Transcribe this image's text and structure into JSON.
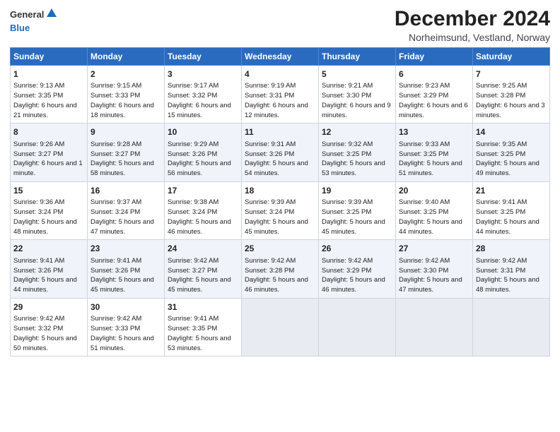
{
  "header": {
    "logo_general": "General",
    "logo_blue": "Blue",
    "title": "December 2024",
    "subtitle": "Norheimsund, Vestland, Norway"
  },
  "columns": [
    "Sunday",
    "Monday",
    "Tuesday",
    "Wednesday",
    "Thursday",
    "Friday",
    "Saturday"
  ],
  "weeks": [
    [
      {
        "day": "1",
        "sunrise": "9:13 AM",
        "sunset": "3:35 PM",
        "daylight": "6 hours and 21 minutes."
      },
      {
        "day": "2",
        "sunrise": "9:15 AM",
        "sunset": "3:33 PM",
        "daylight": "6 hours and 18 minutes."
      },
      {
        "day": "3",
        "sunrise": "9:17 AM",
        "sunset": "3:32 PM",
        "daylight": "6 hours and 15 minutes."
      },
      {
        "day": "4",
        "sunrise": "9:19 AM",
        "sunset": "3:31 PM",
        "daylight": "6 hours and 12 minutes."
      },
      {
        "day": "5",
        "sunrise": "9:21 AM",
        "sunset": "3:30 PM",
        "daylight": "6 hours and 9 minutes."
      },
      {
        "day": "6",
        "sunrise": "9:23 AM",
        "sunset": "3:29 PM",
        "daylight": "6 hours and 6 minutes."
      },
      {
        "day": "7",
        "sunrise": "9:25 AM",
        "sunset": "3:28 PM",
        "daylight": "6 hours and 3 minutes."
      }
    ],
    [
      {
        "day": "8",
        "sunrise": "9:26 AM",
        "sunset": "3:27 PM",
        "daylight": "6 hours and 1 minute."
      },
      {
        "day": "9",
        "sunrise": "9:28 AM",
        "sunset": "3:27 PM",
        "daylight": "5 hours and 58 minutes."
      },
      {
        "day": "10",
        "sunrise": "9:29 AM",
        "sunset": "3:26 PM",
        "daylight": "5 hours and 56 minutes."
      },
      {
        "day": "11",
        "sunrise": "9:31 AM",
        "sunset": "3:26 PM",
        "daylight": "5 hours and 54 minutes."
      },
      {
        "day": "12",
        "sunrise": "9:32 AM",
        "sunset": "3:25 PM",
        "daylight": "5 hours and 53 minutes."
      },
      {
        "day": "13",
        "sunrise": "9:33 AM",
        "sunset": "3:25 PM",
        "daylight": "5 hours and 51 minutes."
      },
      {
        "day": "14",
        "sunrise": "9:35 AM",
        "sunset": "3:25 PM",
        "daylight": "5 hours and 49 minutes."
      }
    ],
    [
      {
        "day": "15",
        "sunrise": "9:36 AM",
        "sunset": "3:24 PM",
        "daylight": "5 hours and 48 minutes."
      },
      {
        "day": "16",
        "sunrise": "9:37 AM",
        "sunset": "3:24 PM",
        "daylight": "5 hours and 47 minutes."
      },
      {
        "day": "17",
        "sunrise": "9:38 AM",
        "sunset": "3:24 PM",
        "daylight": "5 hours and 46 minutes."
      },
      {
        "day": "18",
        "sunrise": "9:39 AM",
        "sunset": "3:24 PM",
        "daylight": "5 hours and 45 minutes."
      },
      {
        "day": "19",
        "sunrise": "9:39 AM",
        "sunset": "3:25 PM",
        "daylight": "5 hours and 45 minutes."
      },
      {
        "day": "20",
        "sunrise": "9:40 AM",
        "sunset": "3:25 PM",
        "daylight": "5 hours and 44 minutes."
      },
      {
        "day": "21",
        "sunrise": "9:41 AM",
        "sunset": "3:25 PM",
        "daylight": "5 hours and 44 minutes."
      }
    ],
    [
      {
        "day": "22",
        "sunrise": "9:41 AM",
        "sunset": "3:26 PM",
        "daylight": "5 hours and 44 minutes."
      },
      {
        "day": "23",
        "sunrise": "9:41 AM",
        "sunset": "3:26 PM",
        "daylight": "5 hours and 45 minutes."
      },
      {
        "day": "24",
        "sunrise": "9:42 AM",
        "sunset": "3:27 PM",
        "daylight": "5 hours and 45 minutes."
      },
      {
        "day": "25",
        "sunrise": "9:42 AM",
        "sunset": "3:28 PM",
        "daylight": "5 hours and 46 minutes."
      },
      {
        "day": "26",
        "sunrise": "9:42 AM",
        "sunset": "3:29 PM",
        "daylight": "5 hours and 46 minutes."
      },
      {
        "day": "27",
        "sunrise": "9:42 AM",
        "sunset": "3:30 PM",
        "daylight": "5 hours and 47 minutes."
      },
      {
        "day": "28",
        "sunrise": "9:42 AM",
        "sunset": "3:31 PM",
        "daylight": "5 hours and 48 minutes."
      }
    ],
    [
      {
        "day": "29",
        "sunrise": "9:42 AM",
        "sunset": "3:32 PM",
        "daylight": "5 hours and 50 minutes."
      },
      {
        "day": "30",
        "sunrise": "9:42 AM",
        "sunset": "3:33 PM",
        "daylight": "5 hours and 51 minutes."
      },
      {
        "day": "31",
        "sunrise": "9:41 AM",
        "sunset": "3:35 PM",
        "daylight": "5 hours and 53 minutes."
      },
      null,
      null,
      null,
      null
    ]
  ]
}
